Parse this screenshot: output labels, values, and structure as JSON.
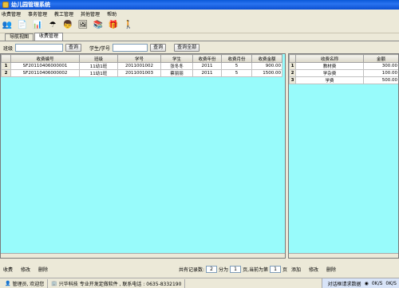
{
  "window": {
    "title": "幼儿园管理系统"
  },
  "menu": [
    "收费管理",
    "事务管理",
    "教工管理",
    "其他管理",
    "帮助"
  ],
  "toolbar": [
    {
      "icon": "users-icon",
      "glyph": "👥"
    },
    {
      "icon": "document-icon",
      "glyph": "📄"
    },
    {
      "icon": "chart-icon",
      "glyph": "📊"
    },
    {
      "icon": "umbrella-icon",
      "glyph": "☂"
    },
    {
      "icon": "person-icon",
      "glyph": "👦"
    },
    {
      "icon": "picture-icon",
      "glyph": "🖼"
    },
    {
      "icon": "books-icon",
      "glyph": "📚"
    },
    {
      "icon": "gift-icon",
      "glyph": "🎁"
    },
    {
      "icon": "exit-icon",
      "glyph": "🚶"
    }
  ],
  "tabs": [
    "导航视图",
    "收费管理"
  ],
  "filter": {
    "class_label": "班级",
    "class_value": "",
    "query1": "查询",
    "student_label": "学生/学号",
    "student_value": "",
    "query2": "查询",
    "query_all": "查询全部"
  },
  "left_grid": {
    "columns": [
      "收费编号",
      "班级",
      "学号",
      "学生",
      "收费年份",
      "收费月份",
      "收费金额"
    ],
    "rows": [
      {
        "num": "1",
        "cells": [
          "SF20110406000001",
          "11幼1班",
          "2011001002",
          "张冬冬",
          "2011",
          "5",
          "900.00"
        ]
      },
      {
        "num": "2",
        "cells": [
          "SF20110406000002",
          "11幼1班",
          "2011001003",
          "蔡丽丽",
          "2011",
          "5",
          "1500.00"
        ]
      }
    ]
  },
  "right_grid": {
    "columns": [
      "收费名称",
      "金额"
    ],
    "rows": [
      {
        "num": "1",
        "cells": [
          "教材费",
          "300.00"
        ]
      },
      {
        "num": "2",
        "cells": [
          "学杂费",
          "100.00"
        ]
      },
      {
        "num": "3",
        "cells": [
          "学费",
          "500.00"
        ]
      }
    ]
  },
  "left_actions": [
    "收费",
    "修改",
    "删除"
  ],
  "pager": {
    "records_label": "共有记录数:",
    "records": "2",
    "pages_label": "分为",
    "pages": "1",
    "current_label": "页,当前为第",
    "current": "1",
    "page_suffix": "页"
  },
  "right_actions": [
    "添加",
    "修改",
    "删除"
  ],
  "status": {
    "user": "管理员, 欢迎您",
    "company": "兴华科技  专业开发定做软件 , 联系电话 : 0635-8332190",
    "tray_text": "对话框请求数据",
    "tray_items": [
      "0K/S",
      "0K/S"
    ]
  }
}
